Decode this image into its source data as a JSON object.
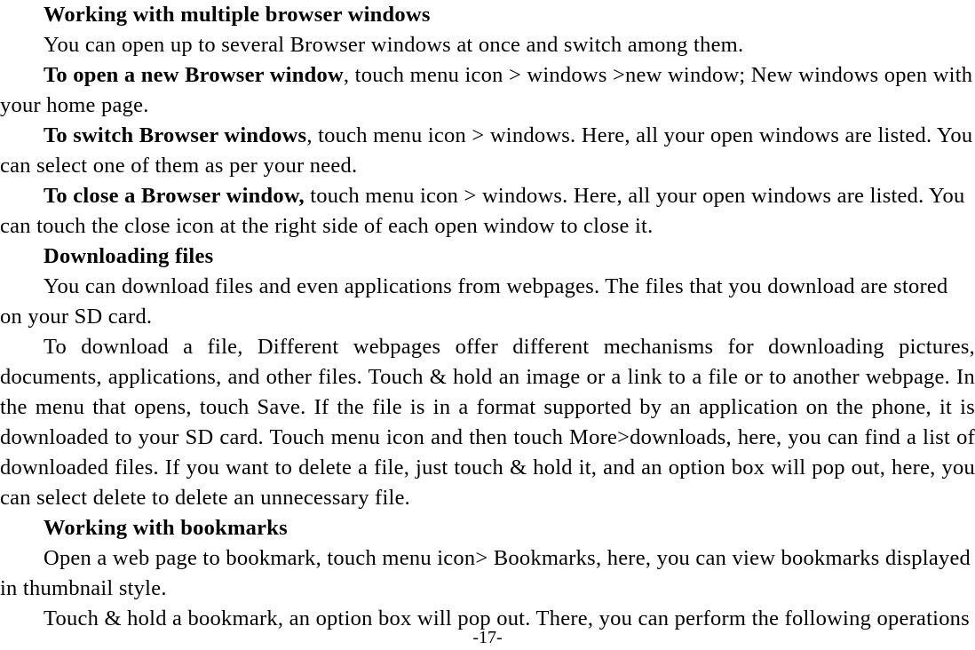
{
  "document": {
    "page_number_label": "-17-",
    "blocks": [
      {
        "id": "heading_multiple_windows",
        "type": "heading",
        "text": "Working with multiple browser windows"
      },
      {
        "id": "para_open_several",
        "type": "paragraph",
        "text": "You can open up to several Browser windows at once and switch among them."
      },
      {
        "id": "para_open_new_window",
        "type": "paragraph_with_lead",
        "lead": "To open a new Browser window",
        "text": ", touch menu icon > windows >new window; New windows open with your home page."
      },
      {
        "id": "para_switch_windows",
        "type": "paragraph_with_lead",
        "lead": "To switch Browser windows",
        "text": ", touch menu icon > windows. Here, all your open windows are listed. You can select one of them as per your need."
      },
      {
        "id": "para_close_window",
        "type": "paragraph_with_lead",
        "lead": "To close a Browser window,",
        "text": " touch menu icon > windows. Here, all your open windows are listed. You can touch the close icon at the right side of each open window to close it."
      },
      {
        "id": "heading_downloading_files",
        "type": "heading",
        "text": "Downloading files"
      },
      {
        "id": "para_download_intro",
        "type": "paragraph",
        "text": "You can download files and even applications from webpages. The files that you download are stored on your SD card."
      },
      {
        "id": "para_download_detail",
        "type": "paragraph_justified",
        "text": "To download a file, Different webpages offer different mechanisms for downloading pictures, documents, applications, and other files. Touch & hold an image or a link to a file or to another webpage. In the menu that opens, touch Save. If the file is in a format supported by an application on the phone, it is downloaded to your SD card. Touch menu icon and then touch More>downloads, here, you can find a list of downloaded files. If you want to delete a file, just touch & hold it, and an option box will pop out, here, you can select delete to delete an unnecessary file."
      },
      {
        "id": "heading_working_bookmarks",
        "type": "heading",
        "text": "Working with bookmarks"
      },
      {
        "id": "para_open_bookmark",
        "type": "paragraph",
        "text": "Open a web page to bookmark, touch menu icon> Bookmarks, here, you can view bookmarks displayed in thumbnail style."
      },
      {
        "id": "para_touch_hold_bookmark",
        "type": "paragraph",
        "text": "Touch & hold a bookmark, an option box will pop out. There, you can perform the following operations"
      }
    ]
  }
}
